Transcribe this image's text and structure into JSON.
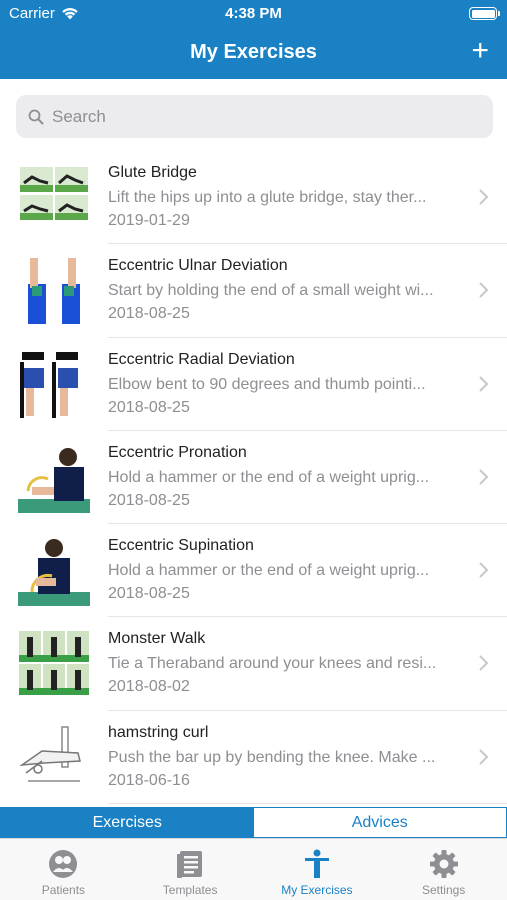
{
  "status_bar": {
    "carrier": "Carrier",
    "time": "4:38 PM"
  },
  "nav": {
    "title": "My Exercises",
    "add_label": "+"
  },
  "search": {
    "placeholder": "Search"
  },
  "exercises": [
    {
      "name": "Glute Bridge",
      "description": "Lift the hips up into a glute bridge, stay ther...",
      "date": "2019-01-29",
      "thumb_icon": "glute-bridge-thumbnail"
    },
    {
      "name": "Eccentric Ulnar Deviation",
      "description": "Start by holding the end of a small weight wi...",
      "date": "2018-08-25",
      "thumb_icon": "ulnar-deviation-thumbnail"
    },
    {
      "name": "Eccentric Radial Deviation",
      "description": "Elbow bent to 90 degrees and thumb pointi...",
      "date": "2018-08-25",
      "thumb_icon": "radial-deviation-thumbnail"
    },
    {
      "name": "Eccentric Pronation",
      "description": "Hold a hammer or the end of a weight uprig...",
      "date": "2018-08-25",
      "thumb_icon": "pronation-thumbnail"
    },
    {
      "name": "Eccentric Supination",
      "description": "Hold a hammer or the end of a weight uprig...",
      "date": "2018-08-25",
      "thumb_icon": "supination-thumbnail"
    },
    {
      "name": "Monster Walk",
      "description": "Tie a Theraband around your knees and resi...",
      "date": "2018-08-02",
      "thumb_icon": "monster-walk-thumbnail"
    },
    {
      "name": "hamstring curl",
      "description": "Push the bar up by bending the knee. Make ...",
      "date": "2018-06-16",
      "thumb_icon": "hamstring-curl-thumbnail"
    }
  ],
  "segments": {
    "exercises": "Exercises",
    "advices": "Advices",
    "selected": "Exercises"
  },
  "tabs": [
    {
      "label": "Patients",
      "icon": "patients-icon",
      "active": false
    },
    {
      "label": "Templates",
      "icon": "templates-icon",
      "active": false
    },
    {
      "label": "My Exercises",
      "icon": "my-exercises-icon",
      "active": true
    },
    {
      "label": "Settings",
      "icon": "settings-icon",
      "active": false
    }
  ],
  "colors": {
    "accent": "#1a82c4",
    "secondary_text": "#8e8e93",
    "separator": "#e6e6e6"
  }
}
